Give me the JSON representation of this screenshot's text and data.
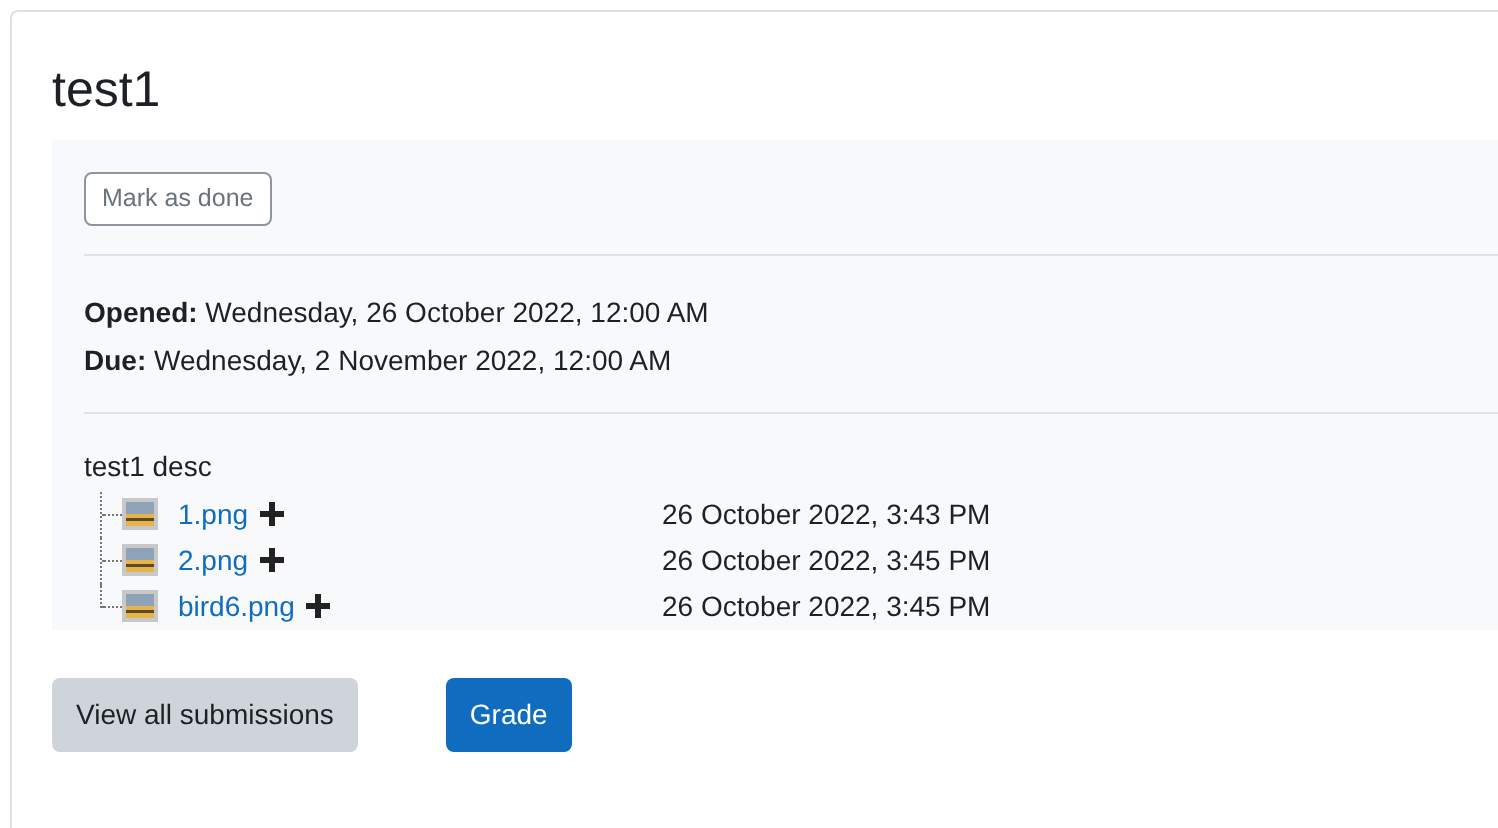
{
  "title": "test1",
  "mark_button": "Mark as done",
  "dates": [
    {
      "label": "Opened:",
      "value": "Wednesday, 26 October 2022, 12:00 AM"
    },
    {
      "label": "Due:",
      "value": "Wednesday, 2 November 2022, 12:00 AM"
    }
  ],
  "description": "test1 desc",
  "files": [
    {
      "name": "1.png",
      "time": "26 October 2022, 3:43 PM"
    },
    {
      "name": "2.png",
      "time": "26 October 2022, 3:45 PM"
    },
    {
      "name": "bird6.png",
      "time": "26 October 2022, 3:45 PM"
    }
  ],
  "buttons": [
    {
      "label": "View all submissions",
      "kind": "secondary"
    },
    {
      "label": "Grade",
      "kind": "primary"
    }
  ]
}
